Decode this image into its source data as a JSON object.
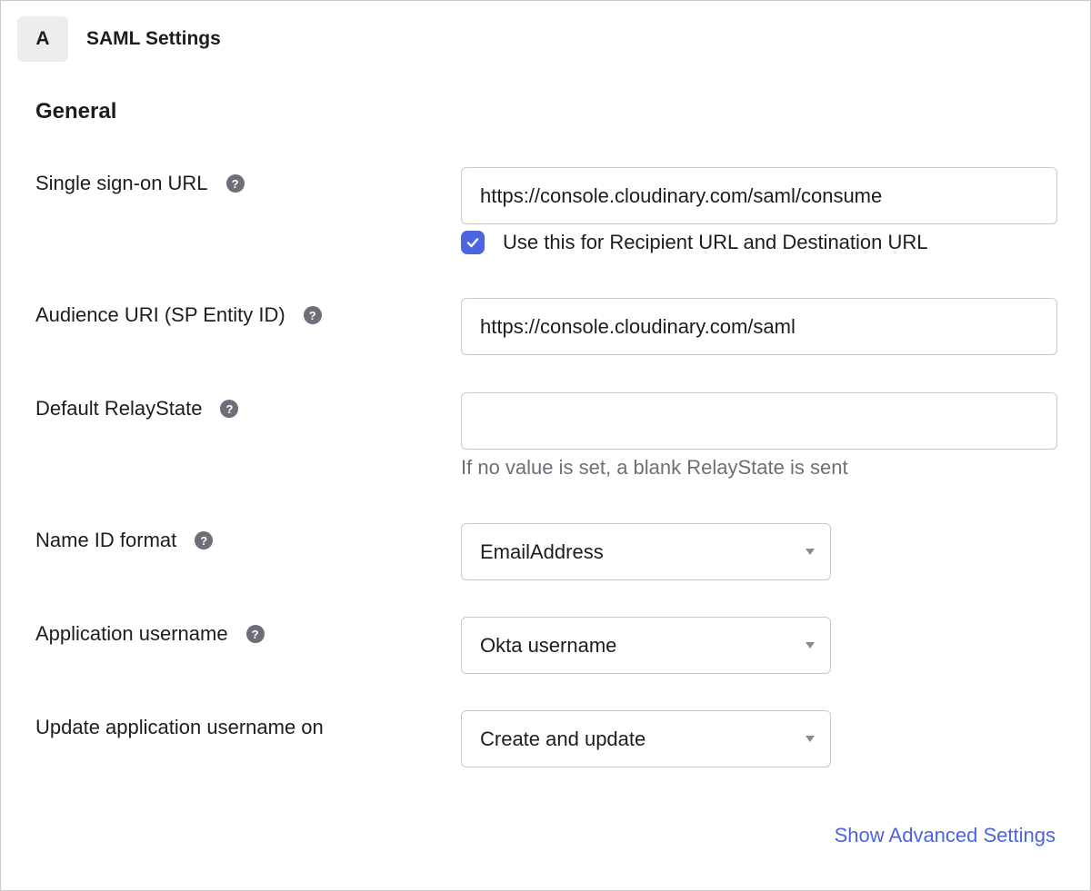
{
  "header": {
    "step_letter": "A",
    "title": "SAML Settings"
  },
  "section": {
    "title": "General"
  },
  "fields": {
    "sso_url": {
      "label": "Single sign-on URL",
      "value": "https://console.cloudinary.com/saml/consume",
      "checkbox_label": "Use this for Recipient URL and Destination URL",
      "checkbox_checked": true
    },
    "audience_uri": {
      "label": "Audience URI (SP Entity ID)",
      "value": "https://console.cloudinary.com/saml"
    },
    "relay_state": {
      "label": "Default RelayState",
      "value": "",
      "hint": "If no value is set, a blank RelayState is sent"
    },
    "name_id_format": {
      "label": "Name ID format",
      "value": "EmailAddress"
    },
    "app_username": {
      "label": "Application username",
      "value": "Okta username"
    },
    "update_username_on": {
      "label": "Update application username on",
      "value": "Create and update"
    }
  },
  "advanced_link": "Show Advanced Settings",
  "icons": {
    "help": "question-mark-circle-icon",
    "caret": "caret-down-icon",
    "check": "checkmark-icon"
  },
  "colors": {
    "accent": "#4c64e1",
    "help_icon": "#6e6e78",
    "border": "#c9c9cc",
    "badge_bg": "#ececee"
  }
}
